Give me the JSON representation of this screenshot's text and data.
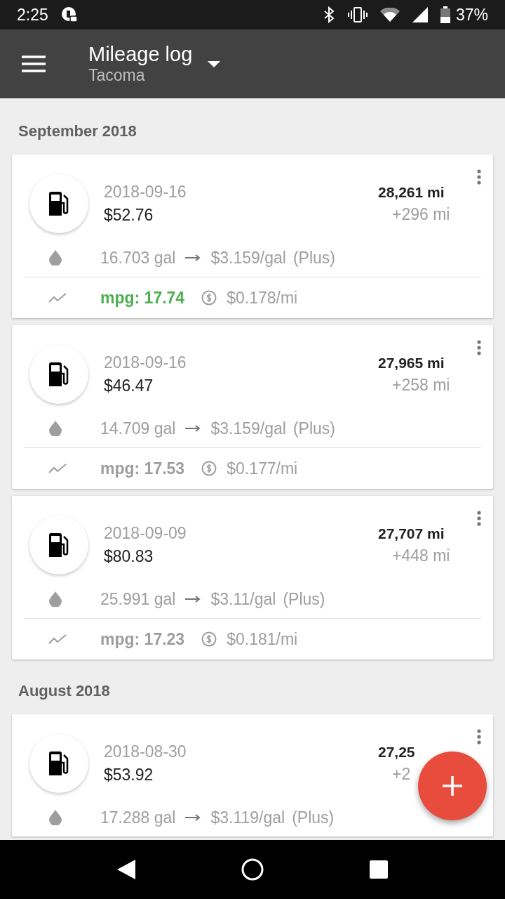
{
  "status_bar": {
    "time": "2:25",
    "battery": "37%"
  },
  "app_bar": {
    "title": "Mileage log",
    "subtitle": "Tacoma"
  },
  "sections": [
    {
      "title": "September 2018",
      "entries": [
        {
          "date": "2018-09-16",
          "cost": "$52.76",
          "odometer": "28,261 mi",
          "distance": "+296 mi",
          "volume": "16.703 gal",
          "price": "$3.159/gal",
          "grade": "(Plus)",
          "mpg": "mpg: 17.74",
          "highlighted": true,
          "cost_per_mile": "$0.178/mi"
        },
        {
          "date": "2018-09-16",
          "cost": "$46.47",
          "odometer": "27,965 mi",
          "distance": "+258 mi",
          "volume": "14.709 gal",
          "price": "$3.159/gal",
          "grade": "(Plus)",
          "mpg": "mpg: 17.53",
          "highlighted": false,
          "cost_per_mile": "$0.177/mi"
        },
        {
          "date": "2018-09-09",
          "cost": "$80.83",
          "odometer": "27,707 mi",
          "distance": "+448 mi",
          "volume": "25.991 gal",
          "price": "$3.11/gal",
          "grade": "(Plus)",
          "mpg": "mpg: 17.23",
          "highlighted": false,
          "cost_per_mile": "$0.181/mi"
        }
      ]
    },
    {
      "title": "August 2018",
      "entries": [
        {
          "date": "2018-08-30",
          "cost": "$53.92",
          "odometer": "27,25",
          "distance": "+2",
          "volume": "17.288 gal",
          "price": "$3.119/gal",
          "grade": "(Plus)"
        }
      ]
    }
  ]
}
